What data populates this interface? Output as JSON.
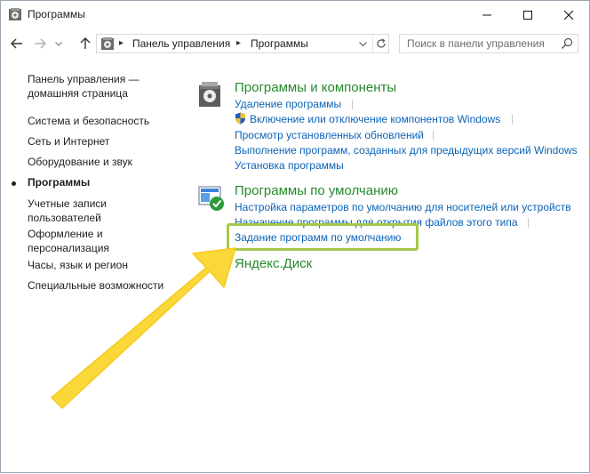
{
  "window": {
    "title": "Программы",
    "colors": {
      "link": "#0a63b7",
      "category": "#268a2c",
      "highlight": "#a5c84a",
      "arrow": "#fbd83a"
    }
  },
  "address": {
    "crumbs": [
      "Панель управления",
      "Программы"
    ]
  },
  "search": {
    "placeholder": "Поиск в панели управления"
  },
  "sidebar": {
    "items": [
      {
        "label_lines": [
          "Панель управления —",
          "домашняя страница"
        ]
      },
      {
        "label": "Система и безопасность"
      },
      {
        "label": "Сеть и Интернет"
      },
      {
        "label": "Оборудование и звук"
      },
      {
        "label": "Программы",
        "current": true
      },
      {
        "label_lines": [
          "Учетные записи",
          "пользователей"
        ]
      },
      {
        "label_lines": [
          "Оформление и",
          "персонализация"
        ]
      },
      {
        "label": "Часы, язык и регион"
      },
      {
        "label": "Специальные возможности"
      }
    ]
  },
  "categories": [
    {
      "title": "Программы и компоненты",
      "links": [
        "Удаление программы",
        "Включение или отключение компонентов Windows",
        "Просмотр установленных обновлений",
        "Выполнение программ, созданных для предыдущих версий Windows",
        "Установка программы"
      ]
    },
    {
      "title": "Программы по умолчанию",
      "links": [
        "Настройка параметров по умолчанию для носителей или устройств",
        "Назначение программы для открытия файлов этого типа",
        "Задание программ по умолчанию"
      ]
    },
    {
      "title": "Яндекс.Диск",
      "links": []
    }
  ]
}
